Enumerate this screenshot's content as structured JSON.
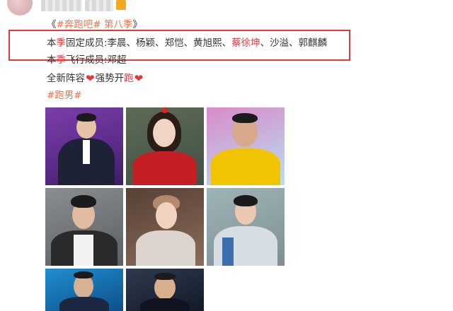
{
  "post": {
    "topic_tag": "#奔跑吧#",
    "season_tag": "第八季",
    "bracket_open": "《",
    "bracket_close": "》",
    "line2_prefix": "本",
    "line2_season": "季",
    "line2_label": "固定成员:李晨、杨颖、郑恺、黄旭熙、",
    "line2_name_highlight": "蔡徐坤",
    "line2_rest": "、沙溢、郭麒麟",
    "line3_prefix": "本",
    "line3_season": "季",
    "line3_label": "飞行成员:邓超",
    "line4_text": "全新阵容",
    "line4_text2": "强势开",
    "line4_highlight": "跑",
    "hashtag": "#跑男#"
  },
  "photos": [
    "photo-li-chen",
    "photo-angelababy",
    "photo-zheng-kai",
    "photo-huang-xu-xi",
    "photo-cai-xu-kun",
    "photo-guo-qi-lin",
    "photo-sha-yi",
    "photo-deng-chao"
  ],
  "colors": {
    "link": "#eb7350",
    "highlight": "#e6393f",
    "box": "#e23b3b",
    "heart": "#e53935"
  }
}
